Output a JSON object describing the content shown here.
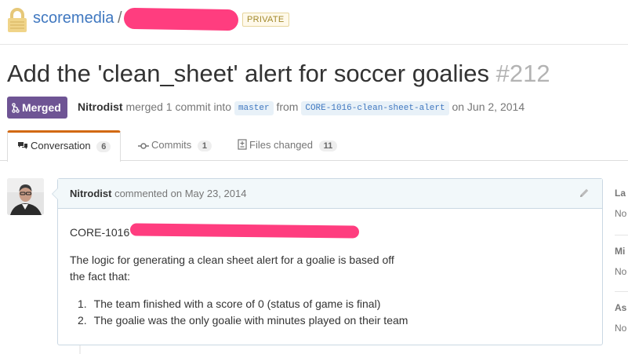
{
  "repo": {
    "owner": "scoremedia",
    "separator": "/",
    "visibility_badge": "PRIVATE"
  },
  "pull_request": {
    "title": "Add the 'clean_sheet' alert for soccer goalies",
    "number": "#212",
    "state_label": "Merged",
    "author": "Nitrodist",
    "action_text": "merged 1 commit into",
    "base_branch": "master",
    "from_text": "from",
    "head_branch": "CORE-1016-clean-sheet-alert",
    "date_text": "on Jun 2, 2014"
  },
  "tabs": [
    {
      "label": "Conversation",
      "count": "6",
      "icon": "comment-discussion-icon"
    },
    {
      "label": "Commits",
      "count": "1",
      "icon": "git-commit-icon"
    },
    {
      "label": "Files changed",
      "count": "11",
      "icon": "diff-icon"
    }
  ],
  "comment": {
    "author": "Nitrodist",
    "action": "commented",
    "timestamp": "on May 23, 2014",
    "ticket": "CORE-1016",
    "paragraph_line1": "The logic for generating a clean sheet alert for a goalie is based off",
    "paragraph_line2": "the fact that:",
    "list": [
      {
        "num": "1.",
        "text": "The team finished with a score of 0 (status of game is final)"
      },
      {
        "num": "2.",
        "text": "The goalie was the only goalie with minutes played on their team"
      }
    ]
  },
  "sidebar": {
    "sections": [
      {
        "heading": "La",
        "value": "No"
      },
      {
        "heading": "Mi",
        "value": "No"
      },
      {
        "heading": "As",
        "value": "No"
      }
    ]
  },
  "colors": {
    "link": "#4078c0",
    "merged": "#6e5494",
    "redaction": "#ff3d7f",
    "tab_accent": "#d26911"
  }
}
